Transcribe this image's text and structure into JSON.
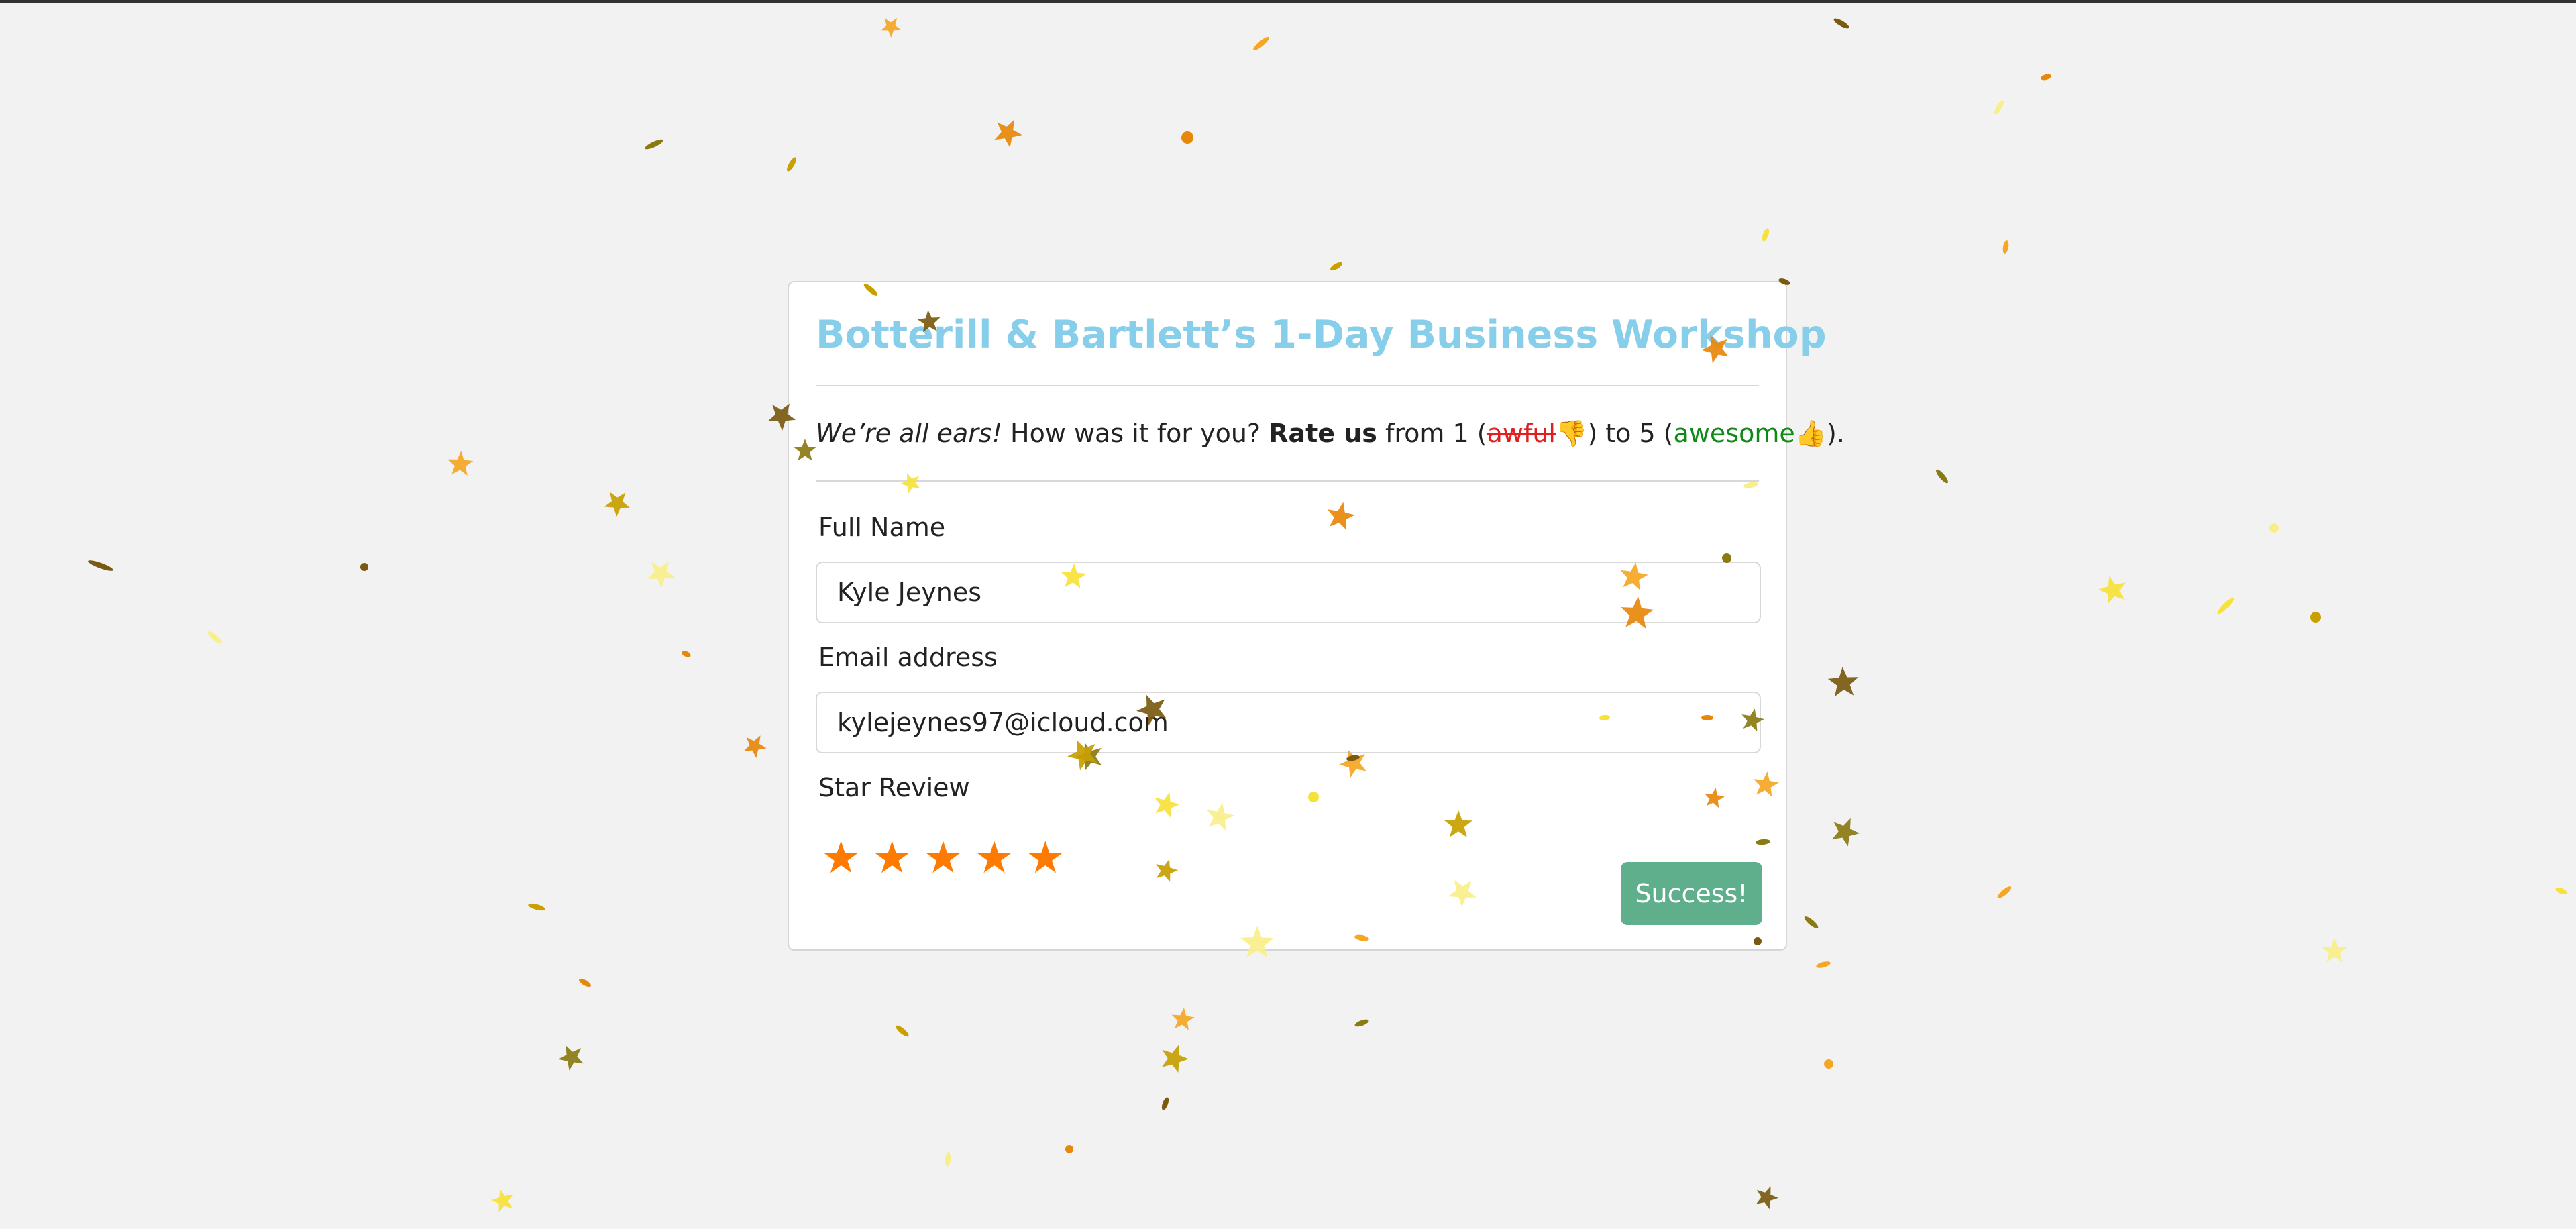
{
  "page": {
    "background": "#f2f2f2"
  },
  "form": {
    "title": "Botterill & Bartlett’s 1-Day Business Workshop",
    "intro": {
      "ears": "We’re all ears!",
      "question": " How was it for you? ",
      "rate": "Rate us",
      "from": " from 1 (",
      "awful": "awful",
      "thumb_down": "👎",
      "to": ") to 5 (",
      "awesome": "awesome",
      "thumb_up": "👍",
      "end": ")."
    },
    "full_name_label": "Full Name",
    "full_name_value": "Kyle Jeynes",
    "email_label": "Email address",
    "email_value": "kylejeynes97@icloud.com",
    "star_label": "Star Review",
    "star_rating": 5,
    "star_max": 5,
    "star_glyph": "★",
    "submit_label": "Success!"
  },
  "colors": {
    "title": "#87ceeb",
    "awful": "#e02020",
    "awesome": "#0f8a16",
    "star": "#ff7a00",
    "button": "#5fae8c"
  },
  "decor": {
    "effect": "confetti",
    "colors": [
      "#f5a623",
      "#e8880a",
      "#7a5a10",
      "#8a7a12",
      "#f7e23a",
      "#f9ef8a",
      "#c8a000"
    ]
  }
}
